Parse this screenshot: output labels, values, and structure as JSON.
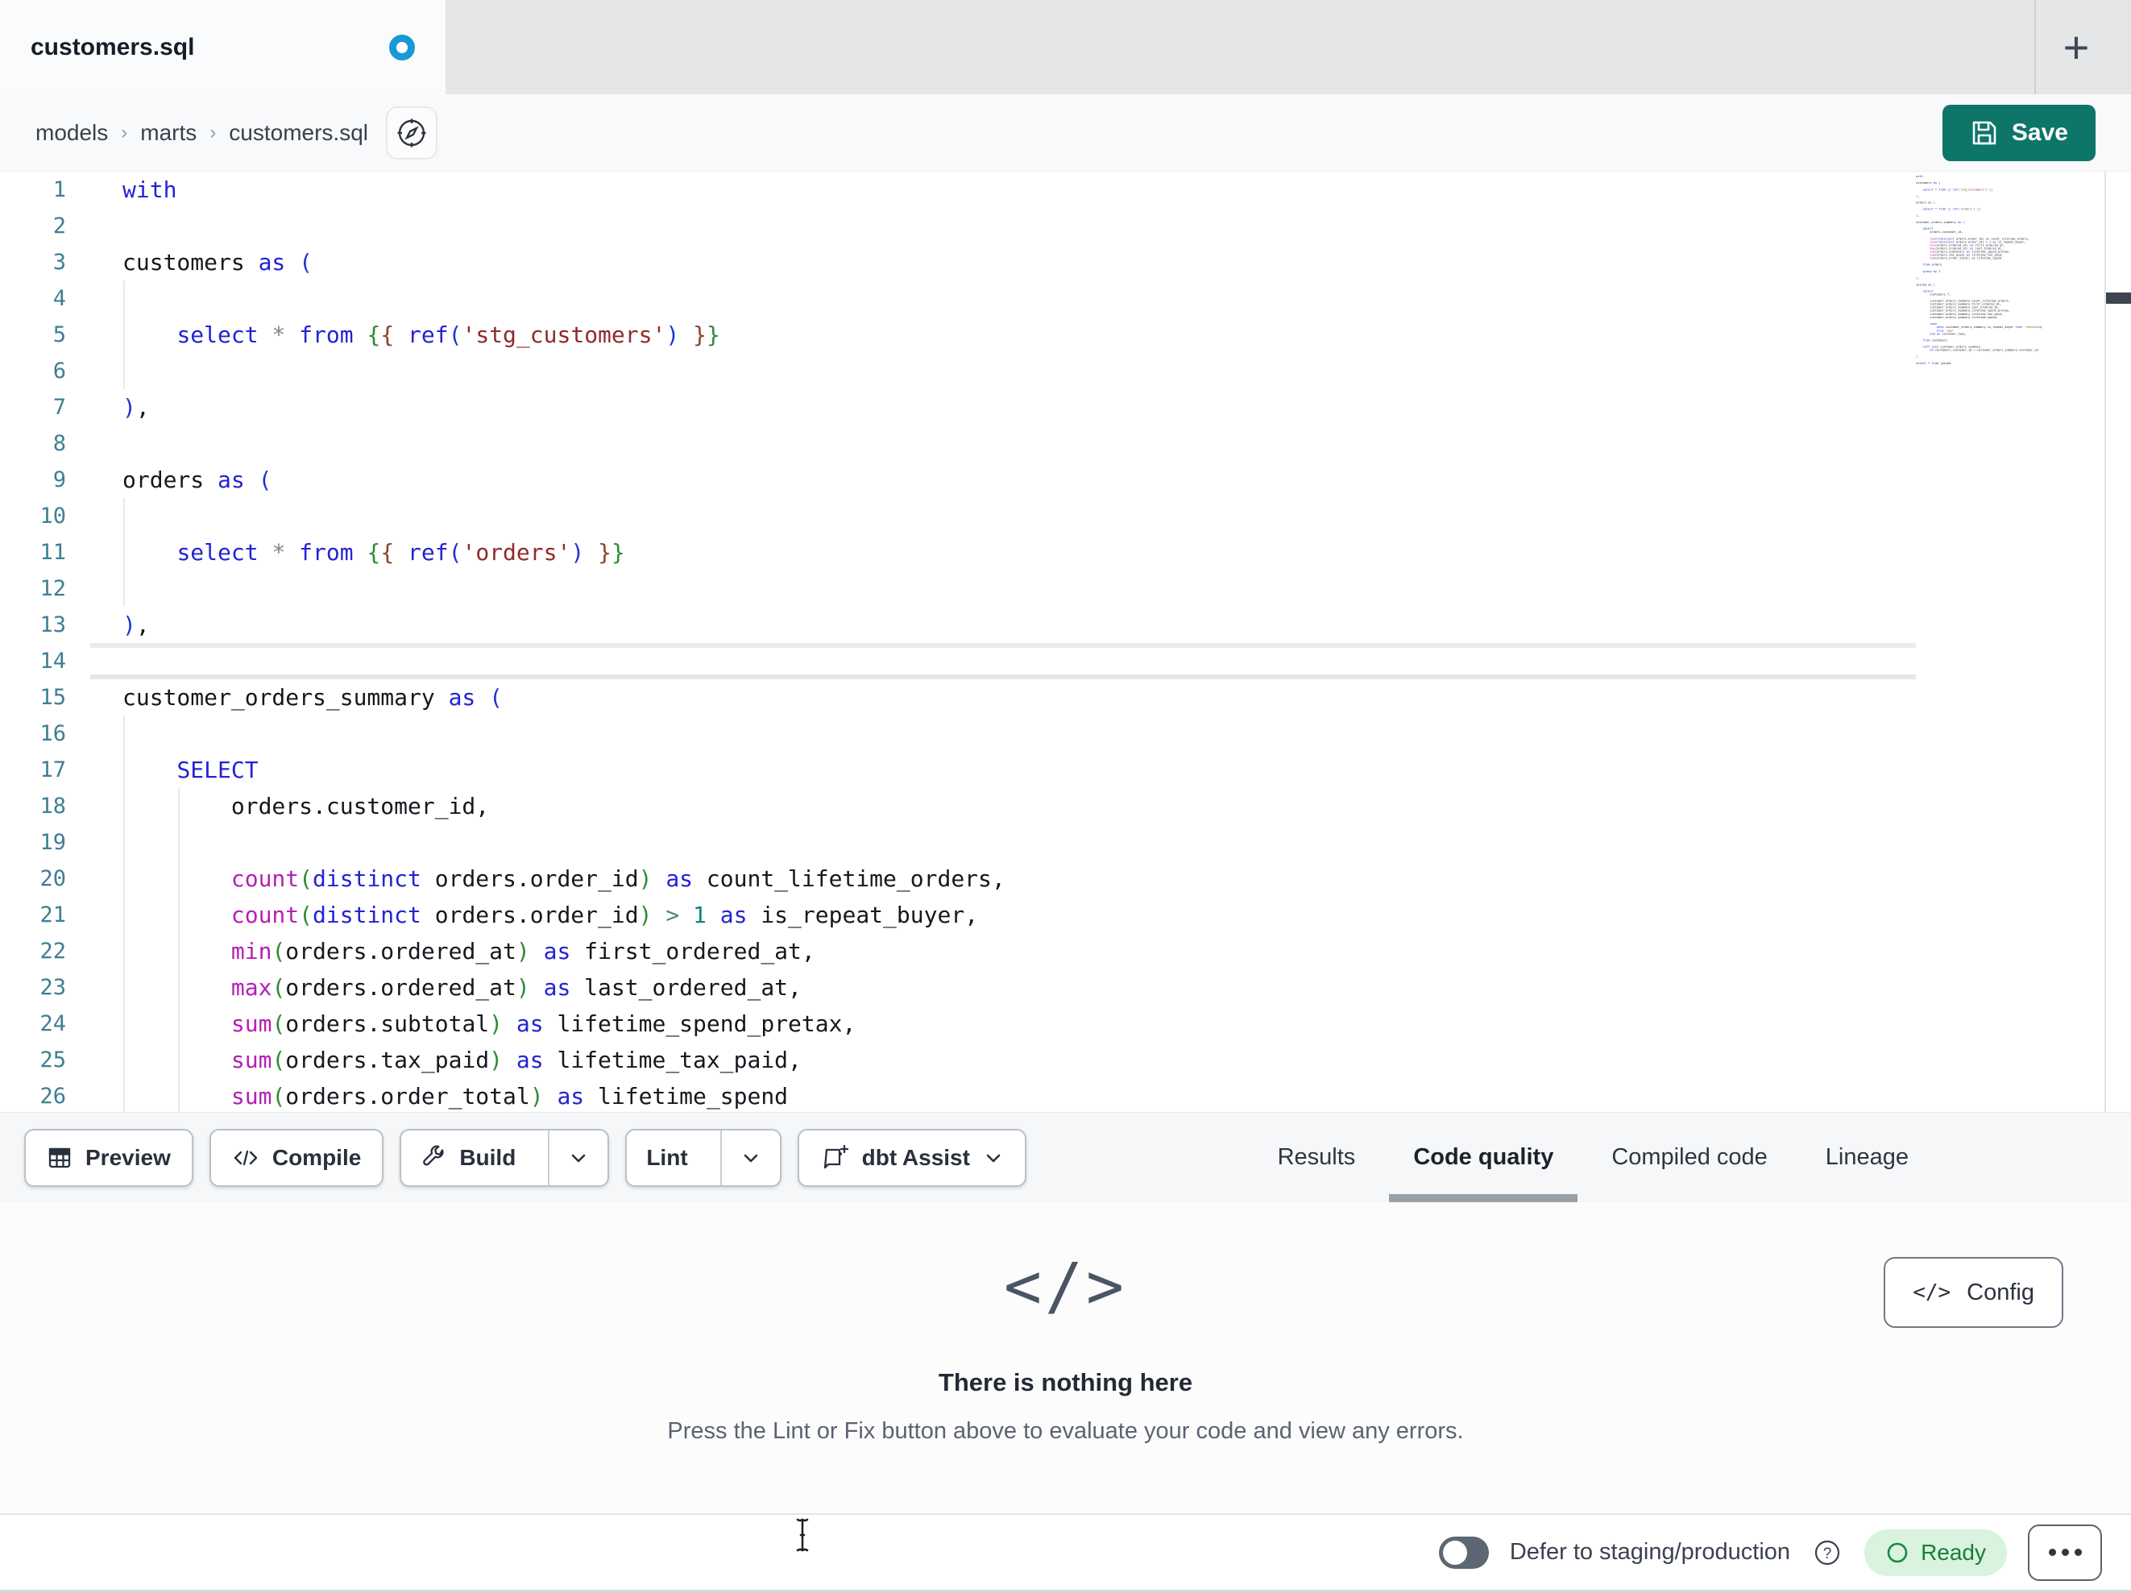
{
  "tab": {
    "title": "customers.sql"
  },
  "breadcrumb": {
    "items": [
      "models",
      "marts",
      "customers.sql"
    ],
    "separator": "›"
  },
  "save": {
    "label": "Save"
  },
  "toolbar": {
    "preview": "Preview",
    "compile": "Compile",
    "build": "Build",
    "lint": "Lint",
    "assist": "dbt Assist"
  },
  "panel_tabs": {
    "items": [
      "Results",
      "Code quality",
      "Compiled code",
      "Lineage"
    ],
    "active": "Code quality"
  },
  "empty": {
    "title": "There is nothing here",
    "subtitle": "Press the Lint or Fix button above to evaluate your code and view any errors."
  },
  "config": {
    "label": "Config"
  },
  "statusbar": {
    "defer_label": "Defer to staging/production",
    "ready": "Ready"
  },
  "colors": {
    "accent_teal": "#0e7569",
    "dirty_dot_blue": "#1899d6",
    "ready_bg": "#d9f3de",
    "ready_text": "#177d3d",
    "keyword_blue": "#2323d3",
    "function_magenta": "#b520b5",
    "string_red": "#8f2b2b",
    "jinja_green": "#2f8b33",
    "line_number_teal": "#3f7e93"
  },
  "editor": {
    "active_line": 14,
    "lines": [
      {
        "n": 1,
        "t": [
          [
            "kw",
            "with"
          ]
        ]
      },
      {
        "n": 2,
        "t": []
      },
      {
        "n": 3,
        "t": [
          [
            "txt",
            "customers "
          ],
          [
            "kw",
            "as"
          ],
          [
            "txt",
            " "
          ],
          [
            "pb",
            "("
          ]
        ]
      },
      {
        "n": 4,
        "t": []
      },
      {
        "n": 5,
        "t": [
          [
            "txt",
            "    "
          ],
          [
            "kw",
            "select"
          ],
          [
            "txt",
            " "
          ],
          [
            "op",
            "*"
          ],
          [
            "txt",
            " "
          ],
          [
            "kw",
            "from"
          ],
          [
            "txt",
            " "
          ],
          [
            "jg",
            "{"
          ],
          [
            "jb",
            "{"
          ],
          [
            "txt",
            " "
          ],
          [
            "kw",
            "ref"
          ],
          [
            "pb",
            "("
          ],
          [
            "str",
            "'stg_customers'"
          ],
          [
            "pb",
            ")"
          ],
          [
            "txt",
            " "
          ],
          [
            "jb",
            "}"
          ],
          [
            "jg",
            "}"
          ]
        ]
      },
      {
        "n": 6,
        "t": []
      },
      {
        "n": 7,
        "t": [
          [
            "pb",
            ")"
          ],
          [
            "txt",
            ","
          ]
        ]
      },
      {
        "n": 8,
        "t": []
      },
      {
        "n": 9,
        "t": [
          [
            "txt",
            "orders "
          ],
          [
            "kw",
            "as"
          ],
          [
            "txt",
            " "
          ],
          [
            "pb",
            "("
          ]
        ]
      },
      {
        "n": 10,
        "t": []
      },
      {
        "n": 11,
        "t": [
          [
            "txt",
            "    "
          ],
          [
            "kw",
            "select"
          ],
          [
            "txt",
            " "
          ],
          [
            "op",
            "*"
          ],
          [
            "txt",
            " "
          ],
          [
            "kw",
            "from"
          ],
          [
            "txt",
            " "
          ],
          [
            "jg",
            "{"
          ],
          [
            "jb",
            "{"
          ],
          [
            "txt",
            " "
          ],
          [
            "kw",
            "ref"
          ],
          [
            "pb",
            "("
          ],
          [
            "str",
            "'orders'"
          ],
          [
            "pb",
            ")"
          ],
          [
            "txt",
            " "
          ],
          [
            "jb",
            "}"
          ],
          [
            "jg",
            "}"
          ]
        ]
      },
      {
        "n": 12,
        "t": []
      },
      {
        "n": 13,
        "t": [
          [
            "pb",
            ")"
          ],
          [
            "txt",
            ","
          ]
        ]
      },
      {
        "n": 14,
        "t": []
      },
      {
        "n": 15,
        "t": [
          [
            "txt",
            "customer_orders_summary "
          ],
          [
            "kw",
            "as"
          ],
          [
            "txt",
            " "
          ],
          [
            "pb",
            "("
          ]
        ]
      },
      {
        "n": 16,
        "t": []
      },
      {
        "n": 17,
        "t": [
          [
            "txt",
            "    "
          ],
          [
            "kw",
            "SELECT"
          ]
        ]
      },
      {
        "n": 18,
        "t": [
          [
            "txt",
            "        orders.customer_id,"
          ]
        ]
      },
      {
        "n": 19,
        "t": []
      },
      {
        "n": 20,
        "t": [
          [
            "txt",
            "        "
          ],
          [
            "fn",
            "count"
          ],
          [
            "pg",
            "("
          ],
          [
            "kw",
            "distinct"
          ],
          [
            "txt",
            " orders.order_id"
          ],
          [
            "pg",
            ")"
          ],
          [
            "txt",
            " "
          ],
          [
            "kw",
            "as"
          ],
          [
            "txt",
            " count_lifetime_orders,"
          ]
        ]
      },
      {
        "n": 21,
        "t": [
          [
            "txt",
            "        "
          ],
          [
            "fn",
            "count"
          ],
          [
            "pg",
            "("
          ],
          [
            "kw",
            "distinct"
          ],
          [
            "txt",
            " orders.order_id"
          ],
          [
            "pg",
            ")"
          ],
          [
            "txt",
            " "
          ],
          [
            "opt",
            ">"
          ],
          [
            "txt",
            " "
          ],
          [
            "num",
            "1"
          ],
          [
            "txt",
            " "
          ],
          [
            "kw",
            "as"
          ],
          [
            "txt",
            " is_repeat_buyer,"
          ]
        ]
      },
      {
        "n": 22,
        "t": [
          [
            "txt",
            "        "
          ],
          [
            "fn",
            "min"
          ],
          [
            "pg",
            "("
          ],
          [
            "txt",
            "orders.ordered_at"
          ],
          [
            "pg",
            ")"
          ],
          [
            "txt",
            " "
          ],
          [
            "kw",
            "as"
          ],
          [
            "txt",
            " first_ordered_at,"
          ]
        ]
      },
      {
        "n": 23,
        "t": [
          [
            "txt",
            "        "
          ],
          [
            "fn",
            "max"
          ],
          [
            "pg",
            "("
          ],
          [
            "txt",
            "orders.ordered_at"
          ],
          [
            "pg",
            ")"
          ],
          [
            "txt",
            " "
          ],
          [
            "kw",
            "as"
          ],
          [
            "txt",
            " last_ordered_at,"
          ]
        ]
      },
      {
        "n": 24,
        "t": [
          [
            "txt",
            "        "
          ],
          [
            "fn",
            "sum"
          ],
          [
            "pg",
            "("
          ],
          [
            "txt",
            "orders.subtotal"
          ],
          [
            "pg",
            ")"
          ],
          [
            "txt",
            " "
          ],
          [
            "kw",
            "as"
          ],
          [
            "txt",
            " lifetime_spend_pretax,"
          ]
        ]
      },
      {
        "n": 25,
        "t": [
          [
            "txt",
            "        "
          ],
          [
            "fn",
            "sum"
          ],
          [
            "pg",
            "("
          ],
          [
            "txt",
            "orders.tax_paid"
          ],
          [
            "pg",
            ")"
          ],
          [
            "txt",
            " "
          ],
          [
            "kw",
            "as"
          ],
          [
            "txt",
            " lifetime_tax_paid,"
          ]
        ]
      },
      {
        "n": 26,
        "t": [
          [
            "txt",
            "        "
          ],
          [
            "fn",
            "sum"
          ],
          [
            "pg",
            "("
          ],
          [
            "txt",
            "orders.order_total"
          ],
          [
            "pg",
            ")"
          ],
          [
            "txt",
            " "
          ],
          [
            "kw",
            "as"
          ],
          [
            "txt",
            " lifetime_spend"
          ]
        ]
      }
    ]
  },
  "minimap": {
    "lines": [
      "with",
      "",
      "customers as (",
      "",
      "    select * from {{ ref('stg_customers') }}",
      "",
      "),",
      "",
      "orders as (",
      "",
      "    select * from {{ ref('orders') }}",
      "",
      "),",
      "",
      "customer_orders_summary as (",
      "",
      "    SELECT",
      "        orders.customer_id,",
      "",
      "        count(distinct orders.order_id) as count_lifetime_orders,",
      "        count(distinct orders.order_id) > 1 as is_repeat_buyer,",
      "        min(orders.ordered_at) as first_ordered_at,",
      "        max(orders.ordered_at) as last_ordered_at,",
      "        sum(orders.subtotal) as lifetime_spend_pretax,",
      "        sum(orders.tax_paid) as lifetime_tax_paid,",
      "        sum(orders.order_total) as lifetime_spend",
      "",
      "    from orders",
      "",
      "    group by 1",
      "",
      "),",
      "",
      "joined as (",
      "",
      "    select",
      "        customers.*,",
      "",
      "        customer_orders_summary.count_lifetime_orders,",
      "        customer_orders_summary.first_ordered_at,",
      "        customer_orders_summary.last_ordered_at,",
      "        customer_orders_summary.lifetime_spend_pretax,",
      "        customer_orders_summary.lifetime_tax_paid,",
      "        customer_orders_summary.lifetime_spend,",
      "",
      "        case",
      "            when customer_orders_summary.is_repeat_buyer then 'returning'",
      "            else 'new'",
      "        end as customer_type,",
      "",
      "    from customers",
      "",
      "    left join customer_orders_summary",
      "        on customers.customer_id = customer_orders_summary.customer_id",
      "",
      ")",
      "",
      "select * from joined"
    ]
  }
}
